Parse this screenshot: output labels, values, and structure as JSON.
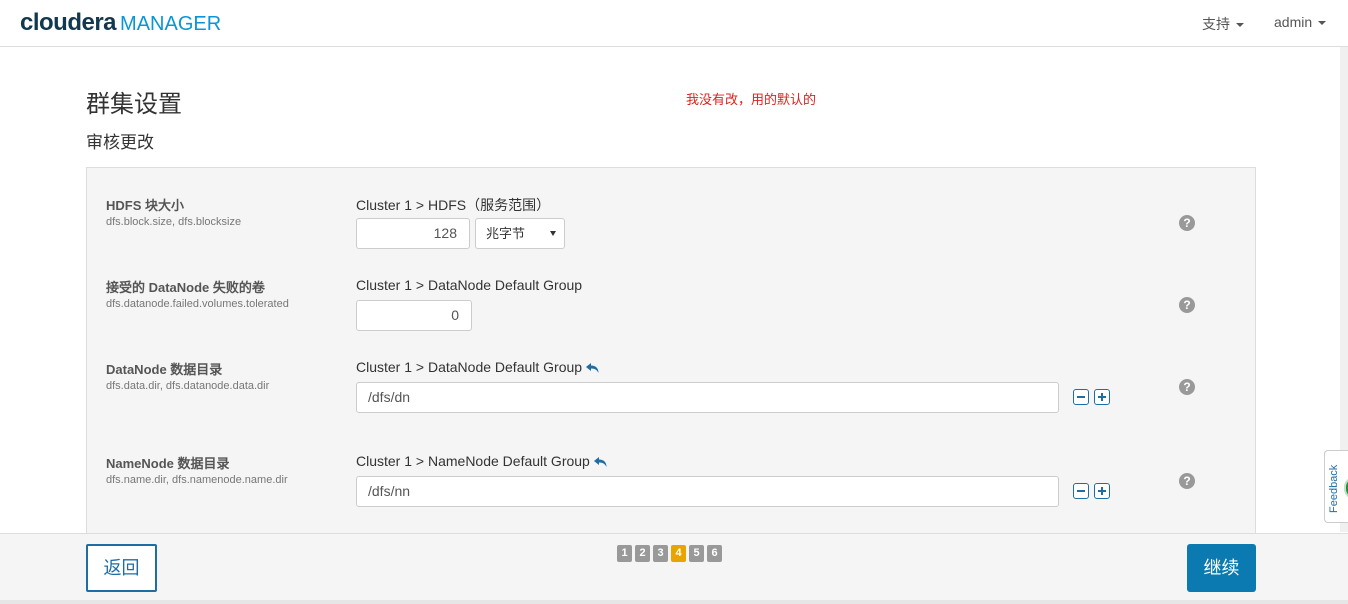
{
  "header": {
    "brand": "cloudera",
    "product": "MANAGER",
    "support_label": "支持",
    "user_label": "admin"
  },
  "page": {
    "title": "群集设置",
    "note": "我没有改，用的默认的",
    "subtitle": "审核更改"
  },
  "params": [
    {
      "label": "HDFS 块大小",
      "keys": "dfs.block.size, dfs.blocksize",
      "scope": "Cluster 1 > HDFS（服务范围）",
      "value": "128",
      "unit": "兆字节"
    },
    {
      "label": "接受的 DataNode 失败的卷",
      "keys": "dfs.datanode.failed.volumes.tolerated",
      "scope": "Cluster 1 > DataNode Default Group",
      "value": "0"
    },
    {
      "label": "DataNode 数据目录",
      "keys": "dfs.data.dir, dfs.datanode.data.dir",
      "scope": "Cluster 1 > DataNode Default Group",
      "value": "/dfs/dn"
    },
    {
      "label": "NameNode 数据目录",
      "keys": "dfs.name.dir, dfs.namenode.name.dir",
      "scope": "Cluster 1 > NameNode Default Group",
      "value": "/dfs/nn"
    }
  ],
  "help_glyph": "?",
  "footer": {
    "back_label": "返回",
    "next_label": "继续",
    "steps": [
      "1",
      "2",
      "3",
      "4",
      "5",
      "6"
    ],
    "active_step": "4"
  },
  "feedback_label": "Feedback",
  "icons": {
    "help": "question-circle-icon",
    "undo": "undo-arrow-icon",
    "remove": "minus-square-icon",
    "add": "plus-square-icon"
  },
  "colors": {
    "brand_dark": "#12384f",
    "brand_light": "#0a96d6",
    "note": "#d9231d",
    "primary": "#0a7ab0",
    "active_step": "#e8a400"
  }
}
